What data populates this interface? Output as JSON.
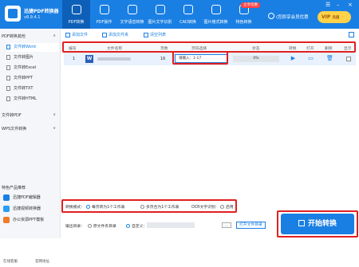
{
  "app": {
    "name": "迅捷PDF转换器",
    "version": "v8.9.4.1"
  },
  "nav": [
    {
      "label": "PDF转换",
      "icon": "pdf-convert-icon"
    },
    {
      "label": "PDF操作",
      "icon": "pdf-operate-icon"
    },
    {
      "label": "文字语音转换",
      "icon": "text-speech-icon"
    },
    {
      "label": "图片文字识别",
      "icon": "ocr-icon"
    },
    {
      "label": "CAD转换",
      "icon": "cad-icon"
    },
    {
      "label": "图片格式转换",
      "icon": "image-format-icon"
    },
    {
      "label": "特色转换",
      "icon": "special-icon"
    }
  ],
  "header": {
    "hot_tag": "立享优惠",
    "login": "(您即享会员优惠",
    "vip_main": "VIP",
    "vip_sub": "充值"
  },
  "sidebar": {
    "group1": "PDF转换其他",
    "items": [
      "文件转Word",
      "文件转图片",
      "文件转Excel",
      "文件转PPT",
      "文件转TXT",
      "文件转HTML"
    ],
    "group2": "文件转PDF",
    "group3": "WPS文件转换",
    "recommend_title": "特色产品推荐",
    "products": [
      "迅捷PDF编辑器",
      "迅捷视频转换器",
      "办公资源PPT模板"
    ],
    "bottom_left": "在线客服",
    "bottom_right": "官网地址"
  },
  "toolbar": {
    "add_file": "添加文件",
    "add_folder": "添加文件夹",
    "clear_list": "清空列表"
  },
  "table": {
    "headers": [
      "编号",
      "文件名称",
      "页数",
      "页码选择",
      "状态",
      "转换",
      "打开",
      "删除",
      "显示"
    ],
    "rows": [
      {
        "num": "1",
        "type": "W",
        "pages": "16",
        "range": "请输入：1-17",
        "status": "0%"
      }
    ]
  },
  "mode": {
    "label": "转换模式：",
    "opt1": "每页转为1个工作表",
    "opt2": "多页合为1个工作表",
    "opt3": "OCR文字识别：",
    "opt3_val": "启用"
  },
  "output": {
    "label": "输出目录：",
    "opt1": "原文件夹目录",
    "opt2": "自定义：",
    "open": "打开文件目录"
  },
  "start": "开始转换"
}
